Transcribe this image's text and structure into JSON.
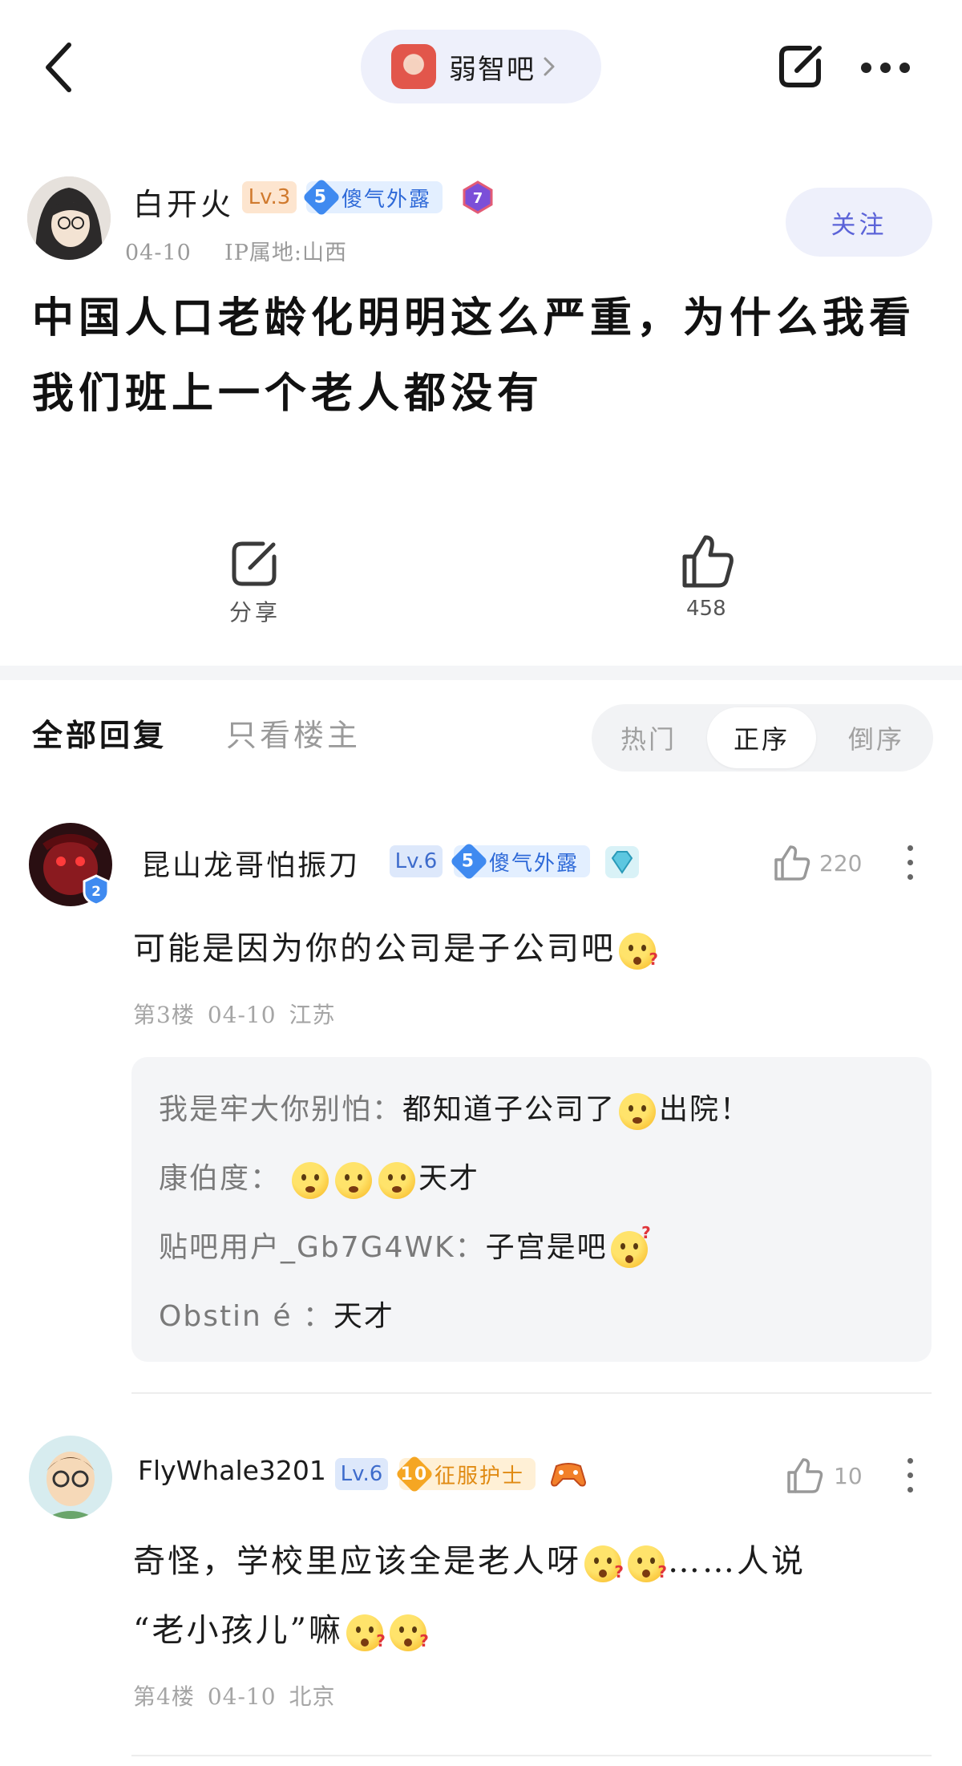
{
  "top_bar": {
    "forum_name": "弱智吧"
  },
  "post": {
    "author": {
      "name": "白开火",
      "level": "Lv.3",
      "title_badge_level": "5",
      "title_badge": "傻气外露",
      "extra_badge": "7",
      "date": "04-10",
      "ip": "IP属地:山西"
    },
    "follow_label": "关注",
    "title": "中国人口老龄化明明这么严重，为什么我看我们班上一个老人都没有",
    "share_label": "分享",
    "like_count": "458"
  },
  "tabs": {
    "all_replies": "全部回复",
    "op_only": "只看楼主",
    "sort": [
      "热门",
      "正序",
      "倒序"
    ],
    "active_sort": "正序"
  },
  "replies": [
    {
      "name": "昆山龙哥怕振刀",
      "avatar_badge": "2",
      "level": "Lv.6",
      "title_badge_level": "5",
      "title_badge": "傻气外露",
      "likes": "220",
      "text": "可能是因为你的公司是子公司吧",
      "floor": "第3楼",
      "date": "04-10",
      "location": "江苏",
      "sub_replies": [
        {
          "user": "我是牢大你别怕：",
          "text": "都知道子公司了",
          "text2": "出院！"
        },
        {
          "user": "康伯度：",
          "text": "天才"
        },
        {
          "user": "贴吧用户_Gb7G4WK：",
          "text": "子宫是吧"
        },
        {
          "user": "Obstin é ：",
          "text": "天才"
        }
      ]
    },
    {
      "name": "FlyWhale3201",
      "level": "Lv.6",
      "title_badge_level": "10",
      "title_badge": "征服护士",
      "likes": "10",
      "text_line1_a": "奇怪，学校里应该全是老人呀",
      "text_line1_b": "……人说",
      "text_line2": "“老小孩儿”嘛",
      "floor": "第4楼",
      "date": "04-10",
      "location": "北京"
    }
  ],
  "colors": {
    "accent": "#5b63d8",
    "pill_bg": "#eef0fb",
    "sub_bg": "#f4f5f7"
  }
}
